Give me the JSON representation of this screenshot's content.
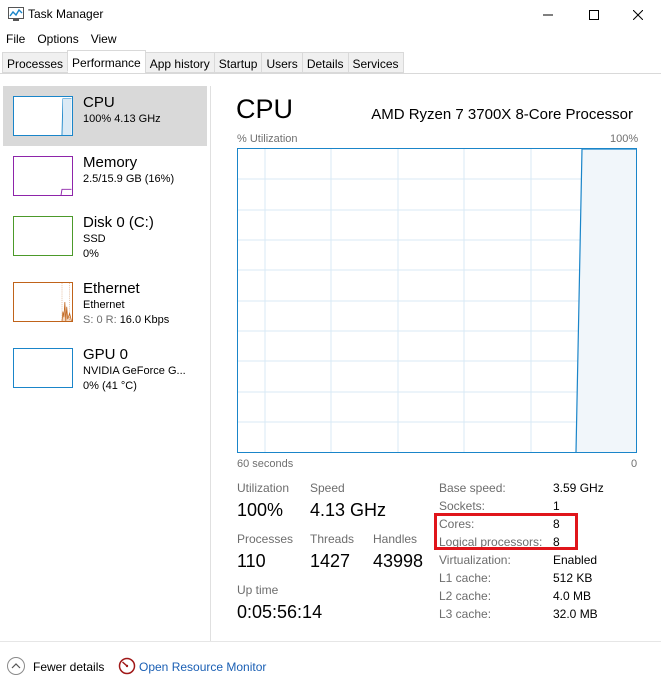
{
  "window": {
    "title": "Task Manager",
    "icon": "task-manager-icon",
    "controls": {
      "minimize": "—",
      "maximize": "☐",
      "close": "✕"
    }
  },
  "menu": [
    "File",
    "Options",
    "View"
  ],
  "tabs": [
    {
      "label": "Processes",
      "active": false
    },
    {
      "label": "Performance",
      "active": true
    },
    {
      "label": "App history",
      "active": false
    },
    {
      "label": "Startup",
      "active": false
    },
    {
      "label": "Users",
      "active": false
    },
    {
      "label": "Details",
      "active": false
    },
    {
      "label": "Services",
      "active": false
    }
  ],
  "sidebar": {
    "items": [
      {
        "name": "CPU",
        "line1": "100%  4.13 GHz",
        "line2": "",
        "color": "#1a85c9",
        "selected": true
      },
      {
        "name": "Memory",
        "line1": "2.5/15.9 GB (16%)",
        "line2": "",
        "color": "#8e24aa",
        "selected": false
      },
      {
        "name": "Disk 0 (C:)",
        "line1": "SSD",
        "line2": "0%",
        "color": "#4c9a2a",
        "selected": false
      },
      {
        "name": "Ethernet",
        "line1": "Ethernet",
        "line2_prefix": "S: 0 R: ",
        "line2_value": "16.0 Kbps",
        "color": "#c0631a",
        "selected": false
      },
      {
        "name": "GPU 0",
        "line1": "NVIDIA GeForce G...",
        "line2": "0% (41 °C)",
        "color": "#1a85c9",
        "selected": false
      }
    ]
  },
  "main": {
    "title": "CPU",
    "processor": "AMD Ryzen 7 3700X 8-Core Processor",
    "graph": {
      "y_label": "% Utilization",
      "y_max": "100%",
      "x_left": "60 seconds",
      "x_right": "0",
      "utilization_current": 100
    },
    "stats": {
      "utilization_label": "Utilization",
      "utilization_value": "100%",
      "speed_label": "Speed",
      "speed_value": "4.13 GHz",
      "processes_label": "Processes",
      "processes_value": "110",
      "threads_label": "Threads",
      "threads_value": "1427",
      "handles_label": "Handles",
      "handles_value": "43998",
      "uptime_label": "Up time",
      "uptime_value": "0:05:56:14"
    },
    "specs": [
      {
        "label": "Base speed:",
        "value": "3.59 GHz"
      },
      {
        "label": "Sockets:",
        "value": "1"
      },
      {
        "label": "Cores:",
        "value": "8"
      },
      {
        "label": "Logical processors:",
        "value": "8"
      },
      {
        "label": "Virtualization:",
        "value": "Enabled"
      },
      {
        "label": "L1 cache:",
        "value": "512 KB"
      },
      {
        "label": "L2 cache:",
        "value": "4.0 MB"
      },
      {
        "label": "L3 cache:",
        "value": "32.0 MB"
      }
    ],
    "highlight_color": "#e0151b"
  },
  "footer": {
    "fewer_details": "Fewer details",
    "open_resource_monitor": "Open Resource Monitor"
  }
}
